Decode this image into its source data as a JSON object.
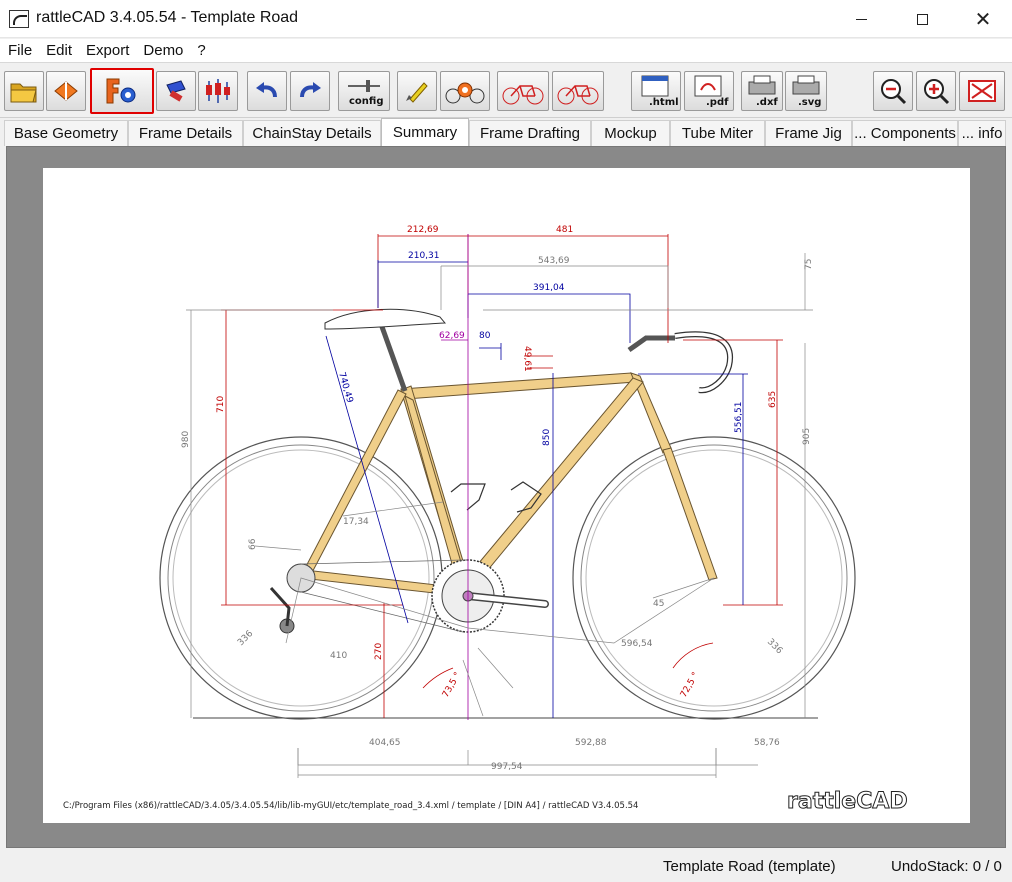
{
  "window": {
    "title": "rattleCAD  3.4.05.54 - Template Road"
  },
  "menu": [
    "File",
    "Edit",
    "Export",
    "Demo",
    "?"
  ],
  "toolbar": {
    "config_label": "config",
    "html_label": ".html",
    "pdf_label": ".pdf",
    "dxf_label": ".dxf",
    "svg_label": ".svg",
    "active_button_color": "#e00000"
  },
  "tabs": [
    {
      "label": "Base Geometry"
    },
    {
      "label": "Frame Details"
    },
    {
      "label": "ChainStay Details"
    },
    {
      "label": "Summary",
      "selected": true
    },
    {
      "label": "Frame Drafting"
    },
    {
      "label": "Mockup"
    },
    {
      "label": "Tube Miter"
    },
    {
      "label": "Frame Jig"
    },
    {
      "label": "... Components"
    },
    {
      "label": "... info"
    }
  ],
  "drawing": {
    "dimensions": {
      "d212": "212,69",
      "d481": "481",
      "d210": "210,31",
      "d543": "543,69",
      "d75": "75",
      "d391": "391,04",
      "d62": "62,69",
      "d80": "80",
      "d4961": "49,61",
      "d740": "740,49",
      "d710": "710",
      "d980": "980",
      "d850": "850",
      "d556": "556,51",
      "d635": "635",
      "d905": "905",
      "d1734": "17,34",
      "d66": "66",
      "d45": "45",
      "d336l": "336",
      "d336r": "336",
      "d410": "410",
      "d270": "270",
      "d596": "596,54",
      "d735": "73,5 °",
      "d725": "72,5 °",
      "d404": "404,65",
      "d592": "592,88",
      "d5876": "58,76",
      "d997": "997,54"
    },
    "footer_path": "C:/Program Files (x86)/rattleCAD/3.4.05/3.4.05.54/lib/lib-myGUI/etc/template_road_3.4.xml   /   template   / [DIN A4]  /   rattleCAD   V3.4.05.54",
    "logo_text": "rattleCAD",
    "colors": {
      "frame": "#f0cf8a",
      "dim_red": "#c00000",
      "dim_blue": "#0000a0",
      "dim_gray": "#808080",
      "dim_magenta": "#a000a0"
    }
  },
  "status": {
    "project": "Template Road (template)",
    "undo": "UndoStack:  0 /  0"
  }
}
